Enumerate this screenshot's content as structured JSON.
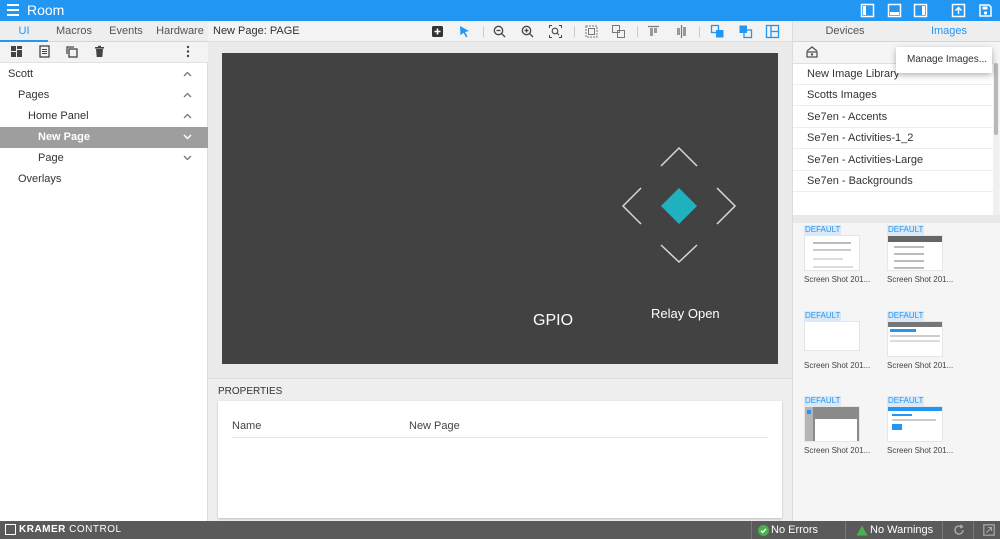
{
  "app": {
    "title": "Room"
  },
  "left_panel": {
    "tabs": [
      {
        "label": "UI"
      },
      {
        "label": "Macros"
      },
      {
        "label": "Events"
      },
      {
        "label": "Hardware"
      }
    ],
    "tree": [
      {
        "label": "Scott",
        "level": 0,
        "expanded": true
      },
      {
        "label": "Pages",
        "level": 1,
        "expanded": true
      },
      {
        "label": "Home Panel",
        "level": 2,
        "expanded": true
      },
      {
        "label": "New Page",
        "level": 3,
        "selected": true
      },
      {
        "label": "Page",
        "level": 3
      },
      {
        "label": "Overlays",
        "level": 1
      }
    ]
  },
  "canvas_toolbar": {
    "title": "New Page: PAGE"
  },
  "canvas": {
    "background": "#424242",
    "accent": "#1fb1bd",
    "labels": {
      "gpio": "GPIO",
      "relay": "Relay Open"
    }
  },
  "properties": {
    "heading": "PROPERTIES",
    "rows": [
      {
        "name": "Name",
        "value": "New Page"
      }
    ]
  },
  "right_panel": {
    "tabs": [
      {
        "label": "Devices"
      },
      {
        "label": "Images",
        "active": true
      }
    ],
    "dropdown": {
      "label": "Manage Images..."
    },
    "libraries": [
      "New Image Library",
      "Scotts Images",
      "Se7en - Accents",
      "Se7en - Activities-1_2",
      "Se7en - Activities-Large",
      "Se7en - Backgrounds"
    ],
    "thumbnails": [
      {
        "badge": "DEFAULT",
        "caption": "Screen Shot 201..."
      },
      {
        "badge": "DEFAULT",
        "caption": "Screen Shot 201..."
      },
      {
        "badge": "DEFAULT",
        "caption": "Screen Shot 201..."
      },
      {
        "badge": "DEFAULT",
        "caption": "Screen Shot 201..."
      },
      {
        "badge": "DEFAULT",
        "caption": "Screen Shot 201..."
      },
      {
        "badge": "DEFAULT",
        "caption": "Screen Shot 201..."
      }
    ]
  },
  "status": {
    "brand_bold": "KRAMER",
    "brand_rest": " CONTROL",
    "errors": "No Errors",
    "warnings": "No Warnings"
  },
  "colors": {
    "primary": "#2196f3",
    "ok": "#4caf50",
    "statusbar": "#5a5a5a"
  }
}
